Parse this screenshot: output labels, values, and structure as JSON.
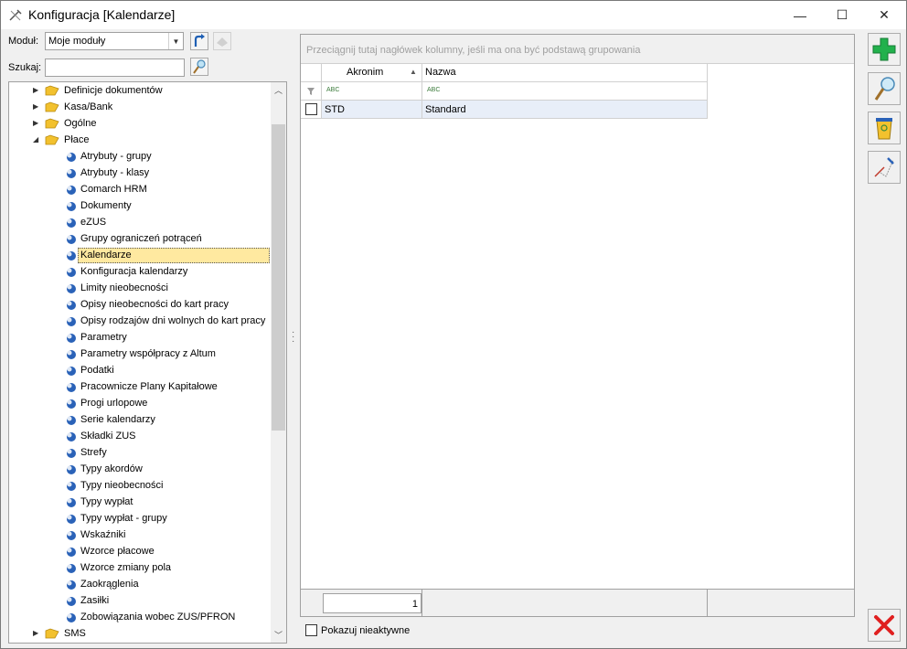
{
  "window": {
    "title": "Konfiguracja [Kalendarze]",
    "minimize_glyph": "—",
    "maximize_glyph": "☐",
    "close_glyph": "✕"
  },
  "toolbar": {
    "module_label": "Moduł:",
    "module_value": "Moje moduły",
    "search_label": "Szukaj:",
    "search_value": ""
  },
  "tree": {
    "items": [
      {
        "label": "Definicje dokumentów",
        "level": 0,
        "expander": "▶",
        "icon": "folder-icon"
      },
      {
        "label": "Kasa/Bank",
        "level": 0,
        "expander": "▶",
        "icon": "folder-icon"
      },
      {
        "label": "Ogólne",
        "level": 0,
        "expander": "▶",
        "icon": "folder-icon"
      },
      {
        "label": "Płace",
        "level": 0,
        "expander": "◢",
        "icon": "folder-icon"
      },
      {
        "label": "Atrybuty - grupy",
        "level": 1,
        "icon": "config-icon"
      },
      {
        "label": "Atrybuty - klasy",
        "level": 1,
        "icon": "config-icon"
      },
      {
        "label": "Comarch HRM",
        "level": 1,
        "icon": "config-icon"
      },
      {
        "label": "Dokumenty",
        "level": 1,
        "icon": "config-icon"
      },
      {
        "label": "eZUS",
        "level": 1,
        "icon": "config-icon"
      },
      {
        "label": "Grupy ograniczeń potrąceń",
        "level": 1,
        "icon": "config-icon"
      },
      {
        "label": "Kalendarze",
        "level": 1,
        "icon": "config-icon",
        "selected": true
      },
      {
        "label": "Konfiguracja kalendarzy",
        "level": 1,
        "icon": "config-icon"
      },
      {
        "label": "Limity nieobecności",
        "level": 1,
        "icon": "config-icon"
      },
      {
        "label": "Opisy nieobecności do kart pracy",
        "level": 1,
        "icon": "config-icon"
      },
      {
        "label": "Opisy rodzajów dni wolnych do kart pracy",
        "level": 1,
        "icon": "config-icon"
      },
      {
        "label": "Parametry",
        "level": 1,
        "icon": "config-icon"
      },
      {
        "label": "Parametry współpracy z Altum",
        "level": 1,
        "icon": "config-icon"
      },
      {
        "label": "Podatki",
        "level": 1,
        "icon": "config-icon"
      },
      {
        "label": "Pracownicze Plany Kapitałowe",
        "level": 1,
        "icon": "config-icon"
      },
      {
        "label": "Progi urlopowe",
        "level": 1,
        "icon": "config-icon"
      },
      {
        "label": "Serie kalendarzy",
        "level": 1,
        "icon": "config-icon"
      },
      {
        "label": "Składki ZUS",
        "level": 1,
        "icon": "config-icon"
      },
      {
        "label": "Strefy",
        "level": 1,
        "icon": "config-icon"
      },
      {
        "label": "Typy akordów",
        "level": 1,
        "icon": "config-icon"
      },
      {
        "label": "Typy nieobecności",
        "level": 1,
        "icon": "config-icon"
      },
      {
        "label": "Typy wypłat",
        "level": 1,
        "icon": "config-icon"
      },
      {
        "label": "Typy wypłat - grupy",
        "level": 1,
        "icon": "config-icon"
      },
      {
        "label": "Wskaźniki",
        "level": 1,
        "icon": "config-icon"
      },
      {
        "label": "Wzorce płacowe",
        "level": 1,
        "icon": "config-icon"
      },
      {
        "label": "Wzorce zmiany pola",
        "level": 1,
        "icon": "config-icon"
      },
      {
        "label": "Zaokrąglenia",
        "level": 1,
        "icon": "config-icon"
      },
      {
        "label": "Zasiłki",
        "level": 1,
        "icon": "config-icon"
      },
      {
        "label": "Zobowiązania wobec ZUS/PFRON",
        "level": 1,
        "icon": "config-icon"
      },
      {
        "label": "SMS",
        "level": 0,
        "expander": "▶",
        "icon": "folder-icon"
      }
    ]
  },
  "grid": {
    "group_hint": "Przeciągnij tutaj nagłówek kolumny, jeśli ma ona być podstawą grupowania",
    "columns": [
      {
        "label": "Akronim",
        "sort": "▲"
      },
      {
        "label": "Nazwa",
        "sort": ""
      }
    ],
    "filter_glyph": "ABC",
    "rows": [
      {
        "akronim": "STD",
        "nazwa": "Standard"
      }
    ],
    "count": "1"
  },
  "footer": {
    "show_inactive_label": "Pokazuj nieaktywne"
  },
  "colors": {
    "selected_bg": "#ffe9a0",
    "folder": "#f2c12e",
    "add_green": "#22b14c",
    "close_red": "#e02020"
  }
}
